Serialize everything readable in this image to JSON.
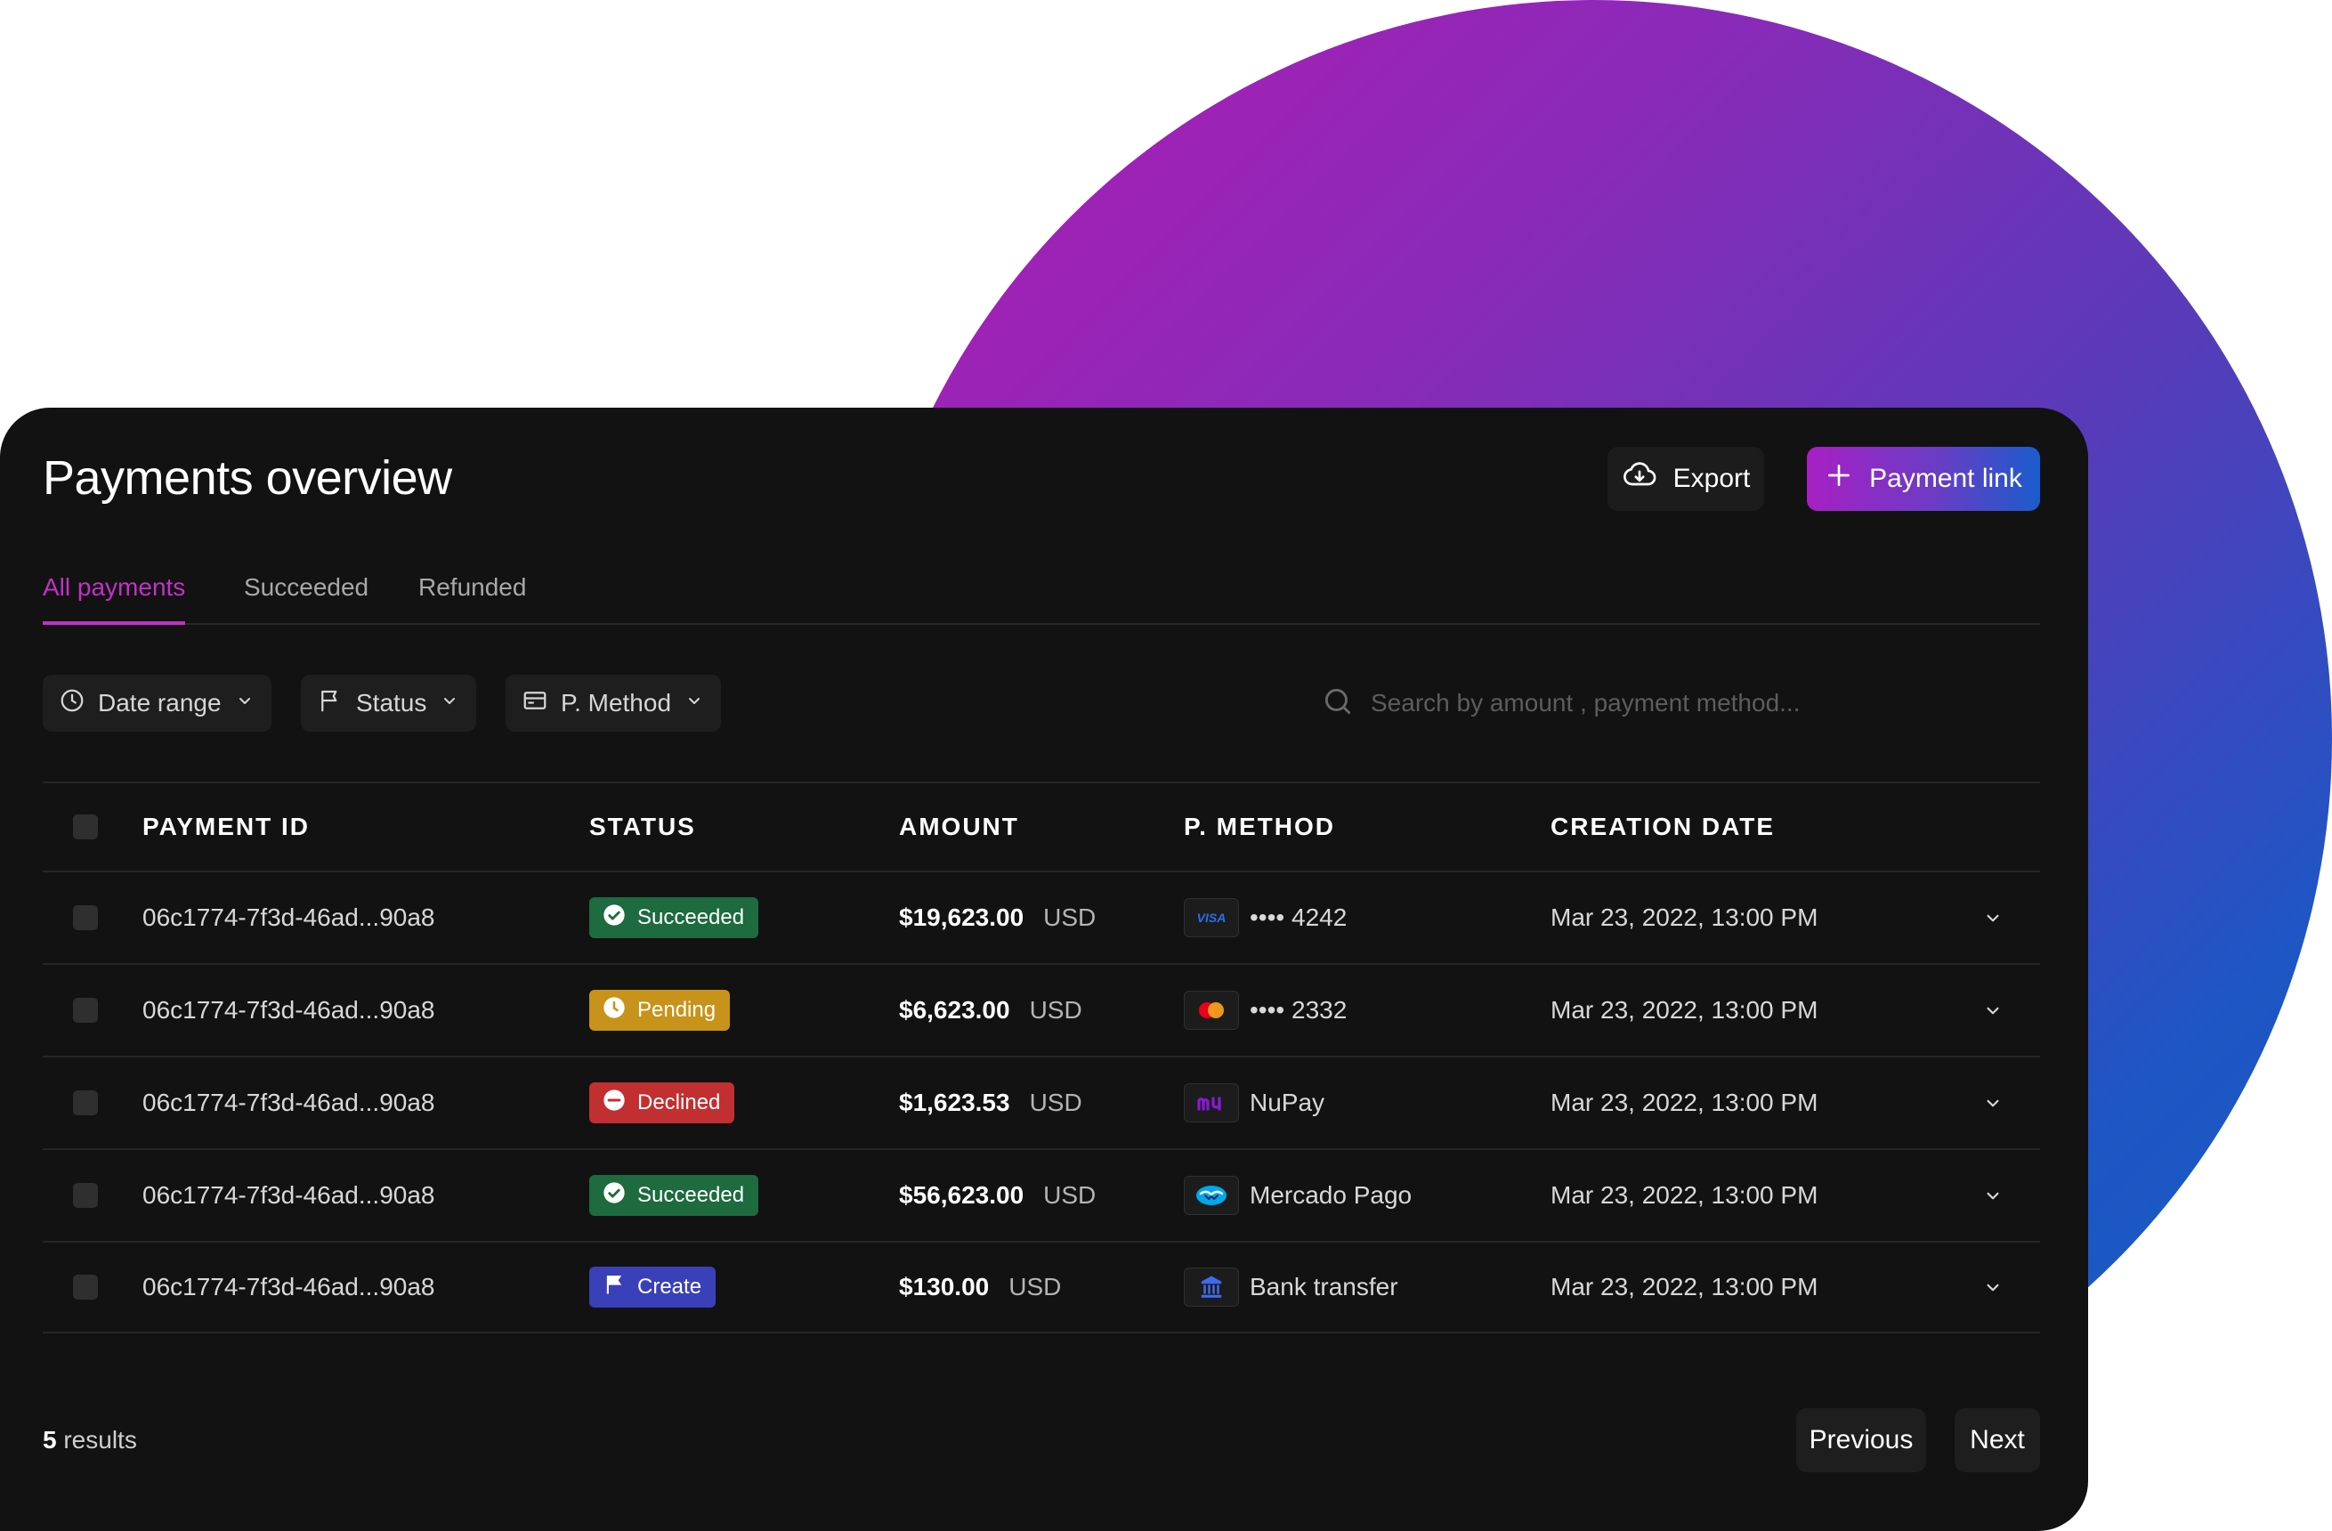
{
  "colors": {
    "background_circle_start": "#b01bb4",
    "background_circle_end": "#0f5fc6",
    "card": "#121212",
    "accent": "#c132c6",
    "succeeded": "#1d6b3f",
    "pending": "#c8931a",
    "declined": "#c22f30",
    "create": "#3a40b8"
  },
  "header": {
    "title": "Payments overview",
    "export_label": "Export",
    "payment_link_label": "Payment link"
  },
  "tabs": [
    {
      "label": "All payments",
      "active": true
    },
    {
      "label": "Succeeded",
      "active": false
    },
    {
      "label": "Refunded",
      "active": false
    }
  ],
  "filters": [
    {
      "label": "Date range",
      "icon": "clock-icon"
    },
    {
      "label": "Status",
      "icon": "flag-icon"
    },
    {
      "label": "P. Method",
      "icon": "card-icon"
    }
  ],
  "search": {
    "placeholder": "Search by amount , payment method..."
  },
  "table": {
    "columns": [
      "PAYMENT ID",
      "STATUS",
      "AMOUNT",
      "P. METHOD",
      "CREATION DATE"
    ],
    "rows": [
      {
        "id": "06c1774-7f3d-46ad...90a8",
        "status": "Succeeded",
        "amount": "$19,623.00",
        "currency": "USD",
        "method": "•••• 4242",
        "method_icon": "visa-icon",
        "date": "Mar 23, 2022, 13:00 PM"
      },
      {
        "id": "06c1774-7f3d-46ad...90a8",
        "status": "Pending",
        "amount": "$6,623.00",
        "currency": "USD",
        "method": "•••• 2332",
        "method_icon": "mastercard-icon",
        "date": "Mar 23, 2022, 13:00 PM"
      },
      {
        "id": "06c1774-7f3d-46ad...90a8",
        "status": "Declined",
        "amount": "$1,623.53",
        "currency": "USD",
        "method": "NuPay",
        "method_icon": "nupay-icon",
        "date": "Mar 23, 2022, 13:00 PM"
      },
      {
        "id": "06c1774-7f3d-46ad...90a8",
        "status": "Succeeded",
        "amount": "$56,623.00",
        "currency": "USD",
        "method": "Mercado Pago",
        "method_icon": "mercado-pago-icon",
        "date": "Mar 23, 2022, 13:00 PM"
      },
      {
        "id": "06c1774-7f3d-46ad...90a8",
        "status": "Create",
        "amount": "$130.00",
        "currency": "USD",
        "method": "Bank transfer",
        "method_icon": "bank-icon",
        "date": "Mar 23, 2022, 13:00 PM"
      }
    ]
  },
  "footer": {
    "count": "5",
    "results_label": "results",
    "previous_label": "Previous",
    "next_label": "Next"
  }
}
